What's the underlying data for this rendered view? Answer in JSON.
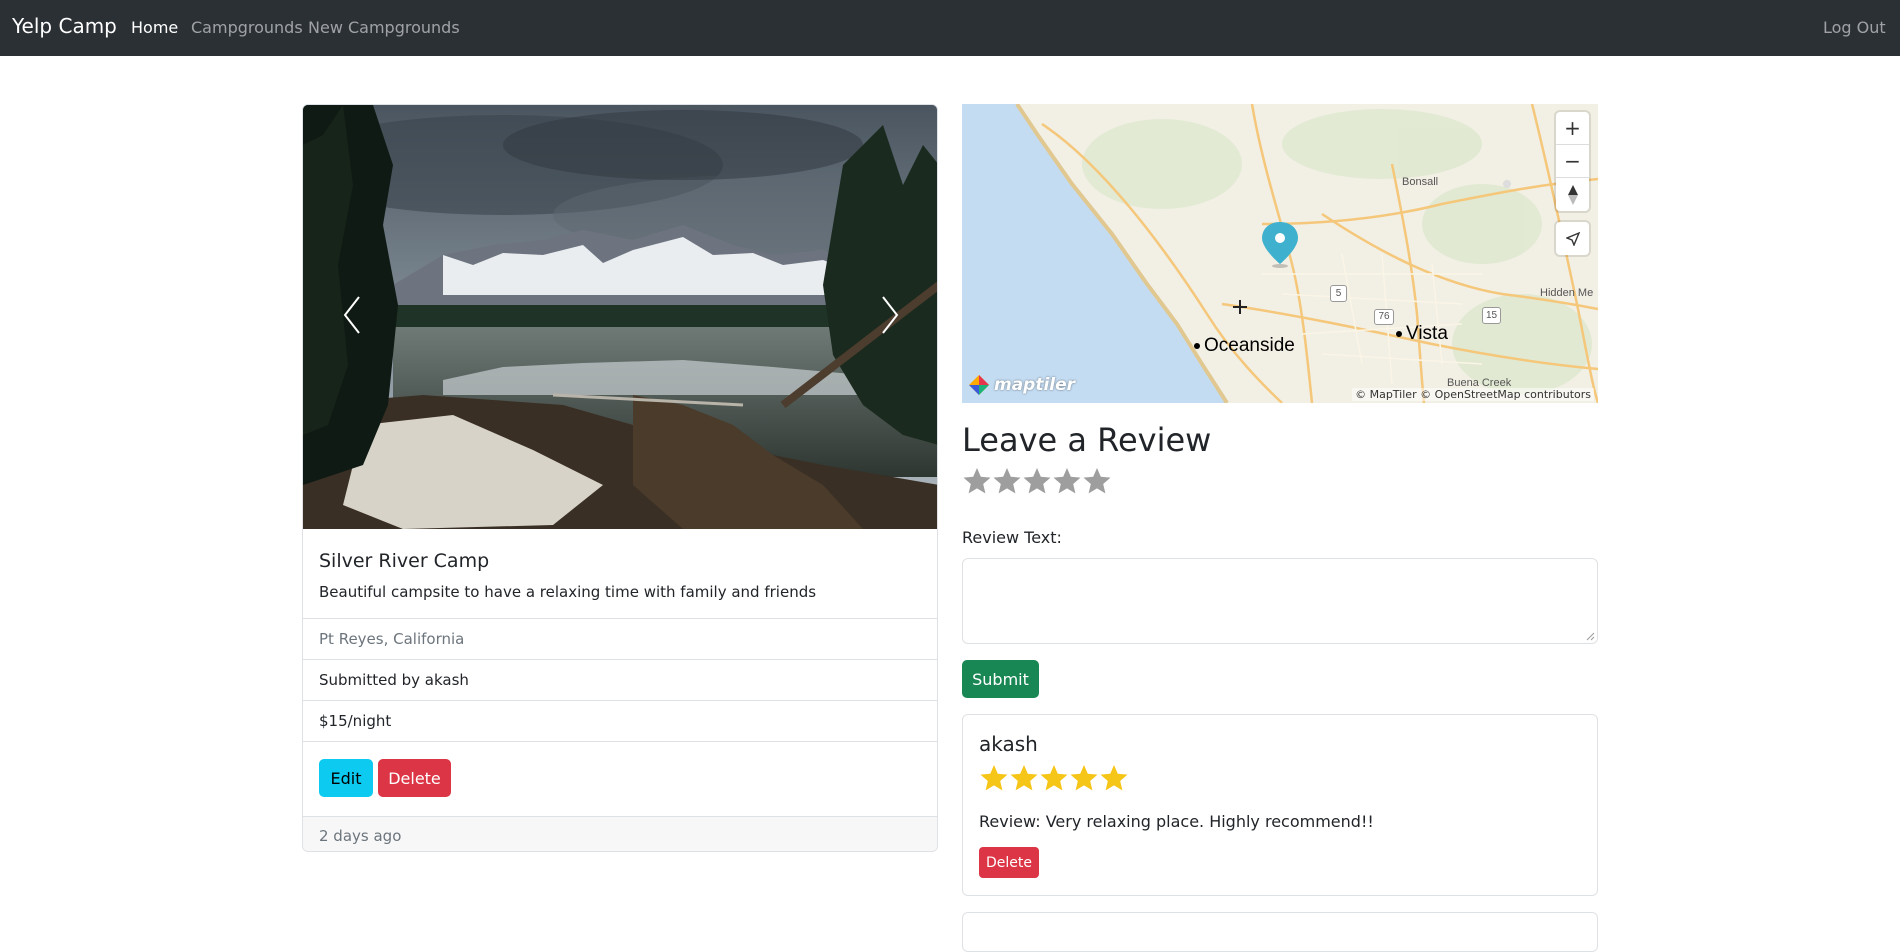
{
  "navbar": {
    "brand": "Yelp Camp",
    "links": [
      "Home",
      "Campgrounds",
      "New Campgrounds"
    ],
    "logout": "Log Out"
  },
  "campground": {
    "title": "Silver River Camp",
    "description": "Beautiful campsite to have a relaxing time with family and friends",
    "location": "Pt Reyes, California",
    "submitted_by": "Submitted by akash",
    "price": "$15/night",
    "edit_label": "Edit",
    "delete_label": "Delete",
    "footer": "2 days ago"
  },
  "map": {
    "cities": [
      "Oceanside",
      "Vista"
    ],
    "places": [
      "Bonsall",
      "Hidden Me",
      "Buena Creek"
    ],
    "shields": [
      "5",
      "76",
      "15"
    ],
    "attribution": "© MapTiler © OpenStreetMap contributors",
    "logo": "maptiler",
    "controls": [
      "+",
      "−"
    ]
  },
  "review_form": {
    "heading": "Leave a Review",
    "rating_value": 0,
    "rating_max": 5,
    "label": "Review Text:",
    "textarea_value": "",
    "submit_label": "Submit"
  },
  "reviews": [
    {
      "author": "akash",
      "rating": 5,
      "text": "Review: Very relaxing place. Highly recommend!!",
      "delete_label": "Delete"
    }
  ],
  "colors": {
    "navbar": "#2b3035",
    "info": "#0dcaf0",
    "danger": "#dc3545",
    "success": "#198754",
    "star_filled": "#f5c518",
    "star_empty": "#9e9e9e",
    "map_water": "#c4dcf2",
    "map_marker": "#3fb1ce"
  }
}
